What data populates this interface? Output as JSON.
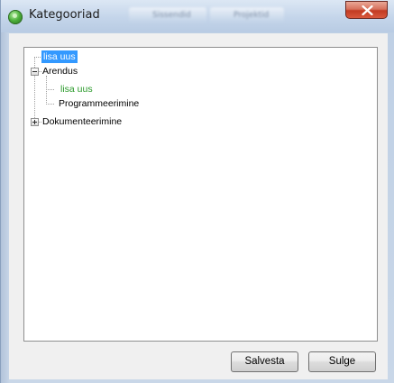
{
  "window": {
    "title": "Kategooriad",
    "background_tabs": [
      "Sissendid",
      "Projektid"
    ]
  },
  "tree": {
    "nodes": [
      {
        "label": "lisa uus",
        "level": 0,
        "state": "selected"
      },
      {
        "label": "Arendus",
        "level": 0,
        "expander": "expanded"
      },
      {
        "label": "lisa uus",
        "level": 1,
        "color": "#2a9a2a"
      },
      {
        "label": "Programmeerimine",
        "level": 1
      },
      {
        "label": "Dokumenteerimine",
        "level": 0,
        "expander": "collapsed"
      }
    ]
  },
  "buttons": {
    "save": "Salvesta",
    "close": "Sulge"
  },
  "icons": {
    "app": "app-globe-icon",
    "close": "close-icon",
    "collapse": "minus-box-icon",
    "expand": "plus-box-icon"
  },
  "colors": {
    "selection": "#3399ff",
    "green_text": "#2a9a2a",
    "close_button": "#c23b22"
  }
}
